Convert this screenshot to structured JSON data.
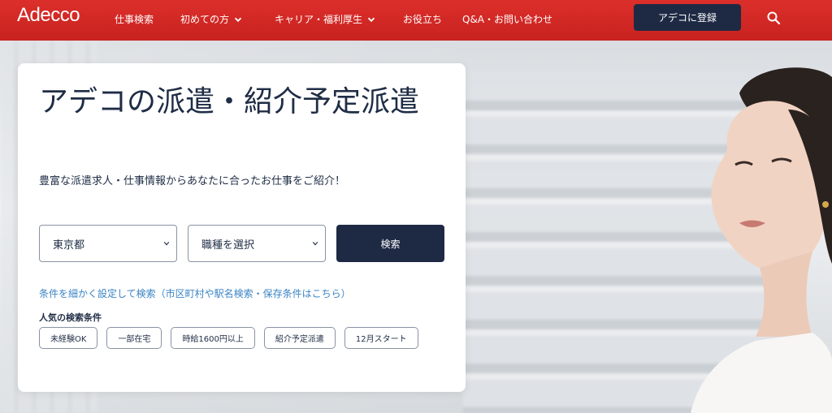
{
  "header": {
    "logo": "Adecco",
    "nav": [
      {
        "label": "仕事検索",
        "dropdown": false
      },
      {
        "label": "初めての方",
        "dropdown": true
      },
      {
        "label": "キャリア・福利厚生",
        "dropdown": true
      },
      {
        "label": "お役立ち",
        "dropdown": false
      },
      {
        "label": "Q&A・お問い合わせ",
        "dropdown": false
      }
    ],
    "register_label": "アデコに登録",
    "search_icon": "search-icon",
    "colors": {
      "header_bg": "#d42a26",
      "button_bg": "#1e2a44"
    }
  },
  "card": {
    "title": "アデコの派遣・紹介予定派遣",
    "subtitle": "豊富な派遣求人・仕事情報からあなたに合ったお仕事をご紹介！",
    "prefecture_select": "東京都",
    "job_type_select": "職種を選択",
    "search_label": "検索",
    "advanced_link": "条件を細かく設定して検索（市区町村や駅名検索・保存条件はこちら）",
    "popular_label": "人気の検索条件",
    "tags": [
      "未経験OK",
      "一部在宅",
      "時給1600円以上",
      "紹介予定派遣",
      "12月スタート"
    ],
    "colors": {
      "link": "#3b84c4",
      "text": "#1f2d45"
    }
  }
}
